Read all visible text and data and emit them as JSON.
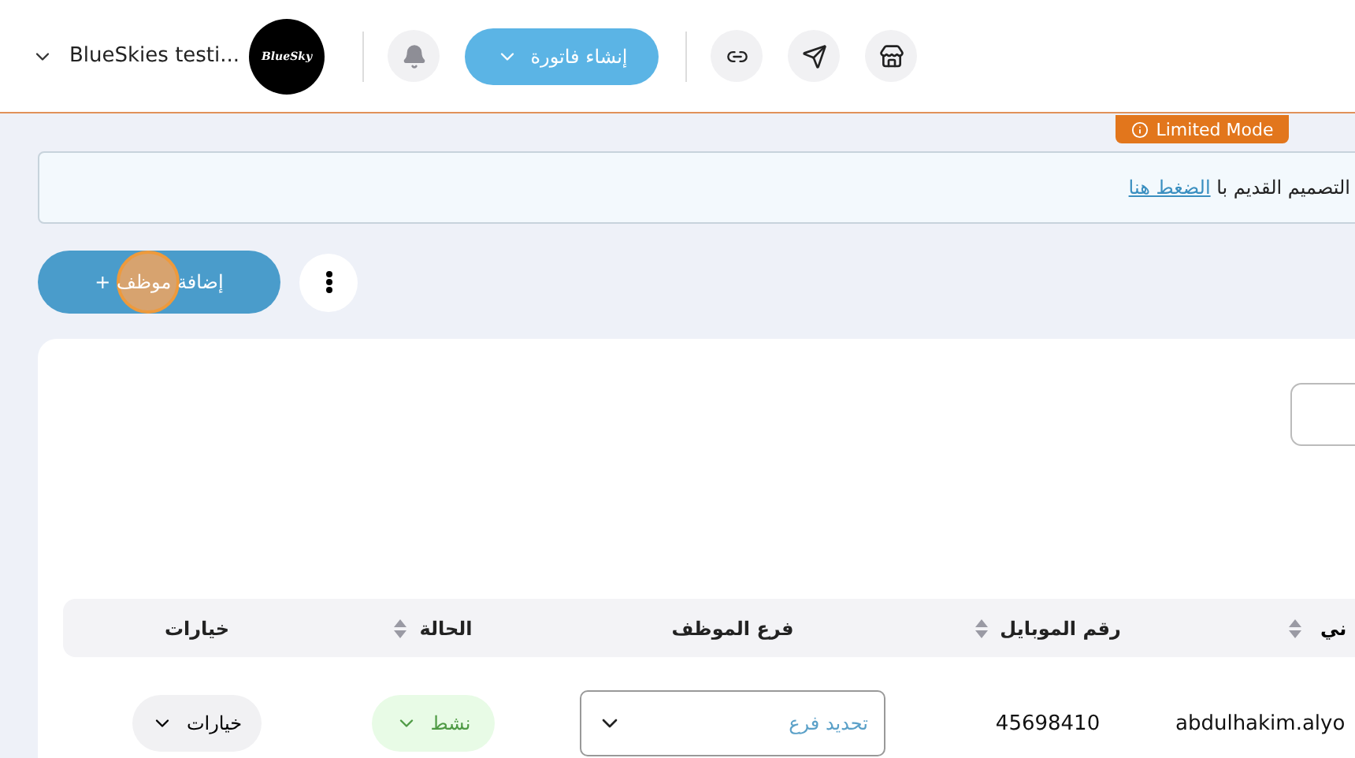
{
  "header": {
    "account": "BlueSkies testi...",
    "logo_text": "BlueSky",
    "create_button": "إنشاء فاتورة"
  },
  "badge": "Limited Mode",
  "banner": {
    "text": "التصميم القديم با",
    "link": "الضغط هنا"
  },
  "add_button": "+ إضافة موظف",
  "table": {
    "columns": [
      {
        "label": "ني",
        "sortable": true
      },
      {
        "label": "رقم الموبايل",
        "sortable": true
      },
      {
        "label": "فرع الموظف",
        "sortable": false
      },
      {
        "label": "الحالة",
        "sortable": true
      },
      {
        "label": "خيارات",
        "sortable": false
      }
    ],
    "rows": [
      {
        "email": "abdulhakim.alyo",
        "mobile": "45698410",
        "branch_placeholder": "تحديد فرع",
        "status": "نشط",
        "options": "خيارات"
      }
    ]
  }
}
